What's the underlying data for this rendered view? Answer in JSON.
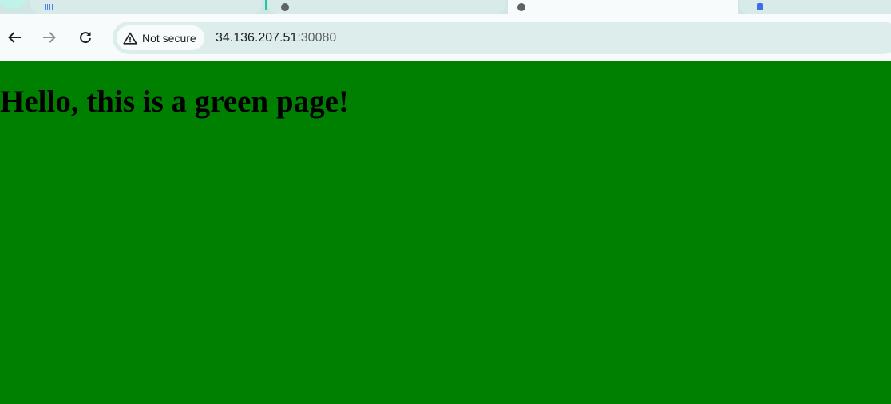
{
  "browser": {
    "toolbar": {
      "back_icon": "arrow-left-icon",
      "forward_icon": "arrow-right-icon",
      "reload_icon": "reload-icon"
    },
    "omnibox": {
      "security_label": "Not secure",
      "security_icon": "warning-triangle-icon",
      "url_host": "34.136.207.51",
      "url_port": ":30080"
    }
  },
  "page": {
    "heading": "Hello, this is a green page!",
    "background_color": "#008000"
  },
  "colors": {
    "tabstrip": "#cfe6e4",
    "toolbar": "#f7fbfb",
    "omnibox": "#dcedeb",
    "page_background": "#008000",
    "heading_text": "#000000"
  }
}
